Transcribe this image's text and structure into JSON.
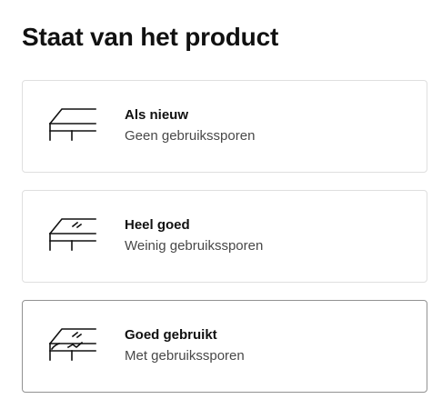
{
  "page": {
    "title": "Staat van het product"
  },
  "options": [
    {
      "title": "Als nieuw",
      "subtitle": "Geen gebruikssporen",
      "icon": "table-new-icon"
    },
    {
      "title": "Heel goed",
      "subtitle": "Weinig gebruikssporen",
      "icon": "table-scratch-light-icon"
    },
    {
      "title": "Goed gebruikt",
      "subtitle": "Met gebruikssporen",
      "icon": "table-scratch-heavy-icon"
    }
  ],
  "colors": {
    "border": "#dfdfdf",
    "selected_border": "#929292",
    "text": "#111111",
    "subtext": "#484848"
  }
}
